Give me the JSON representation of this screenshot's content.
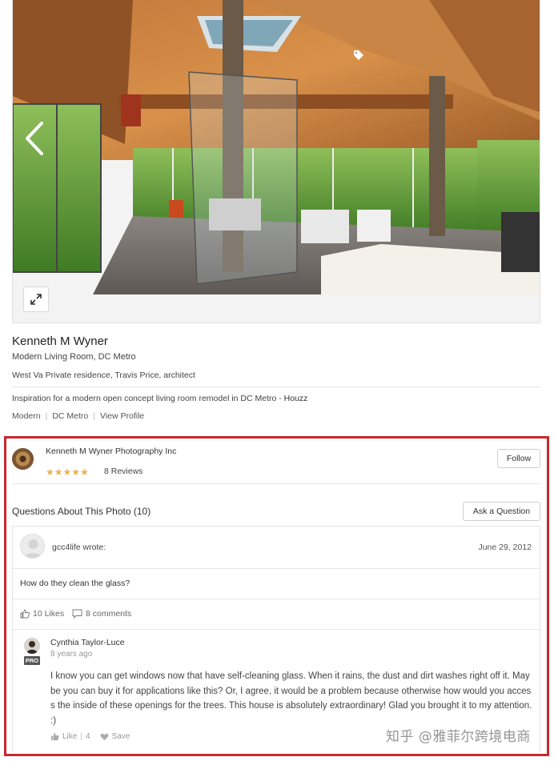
{
  "photo": {
    "alt_icon_prev": "chevron-left-icon",
    "alt_icon_expand": "expand-icon",
    "alt_icon_tag": "tag-icon"
  },
  "info": {
    "author": "Kenneth M Wyner",
    "subtitle": "Modern Living Room, DC Metro",
    "description": "West Va Private residence, Travis Price, architect",
    "inspiration_text": "Inspiration for a modern open concept living room remodel in DC Metro",
    "inspiration_sep": " - ",
    "inspiration_brand": "Houzz",
    "links": [
      "Modern",
      "DC Metro",
      "View Profile"
    ],
    "link_separator": "|"
  },
  "pro": {
    "name": "Kenneth M Wyner Photography Inc",
    "rating_stars": 5,
    "stars_text": "★★★★★",
    "reviews": "8 Reviews",
    "follow_label": "Follow"
  },
  "questions": {
    "title": "Questions About This Photo (10)",
    "ask_label": "Ask a Question",
    "question": {
      "user": "gcc4life wrote:",
      "date": "June 29, 2012",
      "text": "How do they clean the glass?",
      "likes": "10 Likes",
      "comments": "8 comments"
    },
    "comment": {
      "name": "Cynthia Taylor-Luce",
      "badge": "PRO",
      "time": "8 years ago",
      "text": "I know you can get windows now that have self-cleaning glass. When it rains, the dust and dirt washes right off it. Maybe you can buy it for applications like this? Or, I agree, it would be a problem because otherwise how would you access the inside of these openings for the trees. This house is absolutely extraordinary! Glad you brought it to my attention. :)",
      "like_label": "Like",
      "like_count": "4",
      "save_label": "Save"
    }
  },
  "watermark": "知乎 @雅菲尔跨境电商",
  "colors": {
    "highlight_border": "#c8282f",
    "star": "#e8b34a",
    "wood": "#b8703a",
    "forest": "#4f8a2e"
  }
}
